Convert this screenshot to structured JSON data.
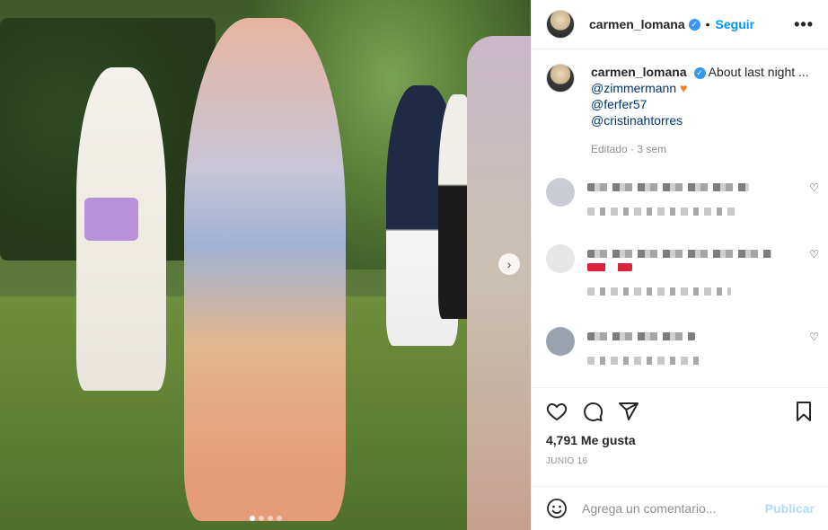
{
  "post": {
    "username": "carmen_lomana",
    "follow_label": "Seguir",
    "separator": "•",
    "more_label": "•••",
    "caption_text": "About last night ...",
    "mentions": [
      "@zimmermann",
      "@ferfer57",
      "@cristinahtorres"
    ],
    "emoji": "♥",
    "edited_label": "Editado · 3 sem",
    "likes_label": "4,791 Me gusta",
    "date_label": "JUNIO 16",
    "comment_placeholder": "Agrega un comentario...",
    "publish_label": "Publicar",
    "carousel": {
      "count": 4,
      "active_index": 0
    }
  },
  "icons": {
    "verified": "verified-check-icon",
    "like": "heart-outline-icon",
    "comment": "speech-bubble-icon",
    "share": "paper-plane-icon",
    "save": "bookmark-icon",
    "emoji": "smiley-icon",
    "next": "chevron-right-icon"
  },
  "colors": {
    "accent": "#0095f6",
    "publish_disabled": "#b3dbff",
    "mention": "#00376b",
    "verified": "#3897f0"
  }
}
